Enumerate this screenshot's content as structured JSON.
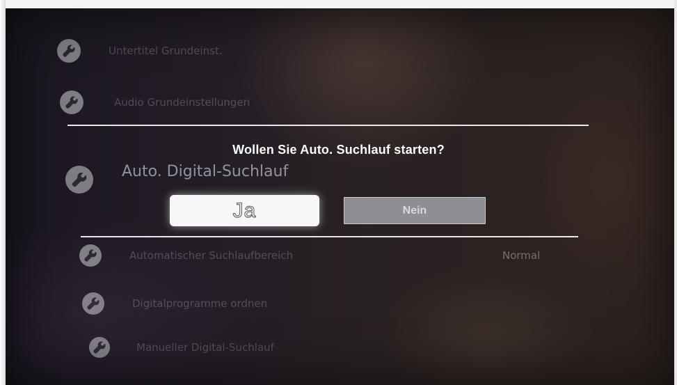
{
  "menu": {
    "items_above": [
      {
        "label": "Untertitel Grundeinst.",
        "icon": "wrench-icon"
      },
      {
        "label": "Audio Grundeinstellungen",
        "icon": "wrench-icon"
      }
    ],
    "section_title": "Auto. Digital-Suchlauf",
    "items_below": [
      {
        "label": "Automatischer Suchlaufbereich",
        "value": "Normal",
        "icon": "wrench-icon"
      },
      {
        "label": "Digitalprogramme ordnen",
        "icon": "wrench-icon"
      },
      {
        "label": "Manueller Digital-Suchlauf",
        "icon": "wrench-icon"
      }
    ]
  },
  "dialog": {
    "question": "Wollen Sie Auto. Suchlauf starten?",
    "yes_label": "Ja",
    "no_label": "Nein",
    "selected": "Ja"
  },
  "colors": {
    "selected_button": "#f7f7f7",
    "unselected_button": "#8e8e94",
    "divider": "#e8e8ee",
    "title_text": "#ffffff"
  }
}
